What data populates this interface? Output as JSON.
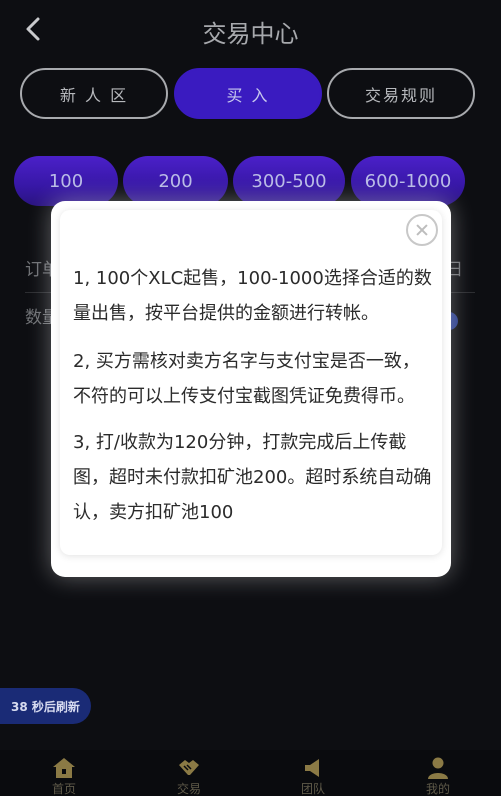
{
  "header": {
    "title": "交易中心"
  },
  "tabs": [
    {
      "label": "新 人 区"
    },
    {
      "label": "买 入"
    },
    {
      "label": "交易规则"
    }
  ],
  "chips": [
    {
      "label": "100"
    },
    {
      "label": "200"
    },
    {
      "label": "300-500"
    },
    {
      "label": "600-1000"
    }
  ],
  "background": {
    "order_label": "订单",
    "order_suffix": "日",
    "qty_label": "数量"
  },
  "modal": {
    "rules": [
      "1, 100个XLC起售，100-1000选择合适的数量出售，按平台提供的金额进行转帐。",
      "2, 买方需核对卖方名字与支付宝是否一致，不符的可以上传支付宝截图凭证免费得币。",
      "3, 打/收款为120分钟，打款完成后上传截图，超时未付款扣矿池200。超时系统自动确认，卖方扣矿池100"
    ]
  },
  "refresh": {
    "label": "38 秒后刷新"
  },
  "tabbar": [
    {
      "label": "首页",
      "icon": "home-icon"
    },
    {
      "label": "交易",
      "icon": "handshake-icon"
    },
    {
      "label": "团队",
      "icon": "megaphone-icon"
    },
    {
      "label": "我的",
      "icon": "user-icon"
    }
  ],
  "colors": {
    "accent": "#3a1bc0",
    "background": "#0d0e12",
    "tabbar_icon": "#8b7a45"
  }
}
